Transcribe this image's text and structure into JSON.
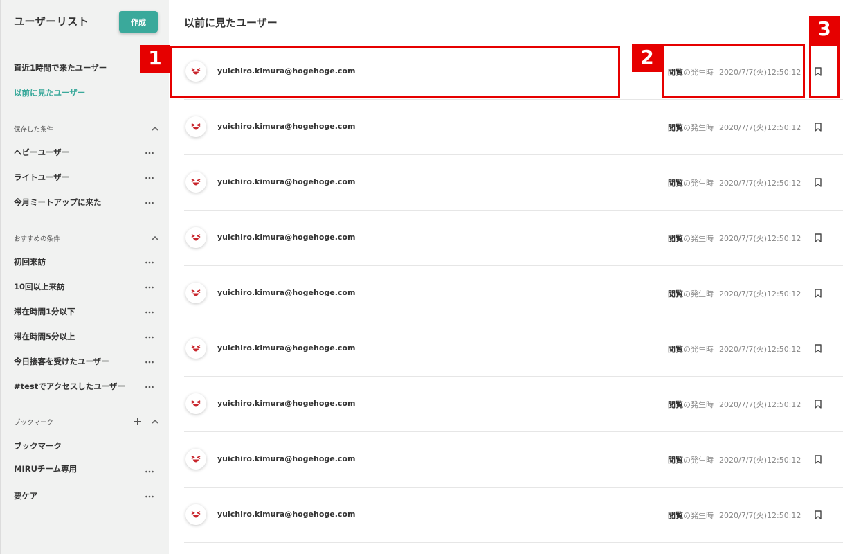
{
  "sidebar": {
    "title": "ユーザーリスト",
    "create_label": "作成",
    "top_items": [
      {
        "label": "直近1時間で来たユーザー"
      },
      {
        "label": "以前に見たユーザー"
      }
    ],
    "saved_section": {
      "label": "保存した条件",
      "items": [
        {
          "label": "ヘビーユーザー"
        },
        {
          "label": "ライトユーザー"
        },
        {
          "label": "今月ミートアップに来た"
        }
      ]
    },
    "recommended_section": {
      "label": "おすすめの条件",
      "items": [
        {
          "label": "初回来訪"
        },
        {
          "label": "10回以上来訪"
        },
        {
          "label": "滞在時間1分以下"
        },
        {
          "label": "滞在時間5分以上"
        },
        {
          "label": "今日接客を受けたユーザー"
        },
        {
          "label": "#testでアクセスしたユーザー"
        }
      ]
    },
    "bookmark_section": {
      "label": "ブックマーク",
      "items": [
        {
          "label": "ブックマーク"
        },
        {
          "label": "MIRUチーム専用"
        },
        {
          "label": "要ケア"
        }
      ]
    }
  },
  "main": {
    "title": "以前に見たユーザー",
    "rows": [
      {
        "email": "yuichiro.kimura@hogehoge.com",
        "event_kind": "閲覧",
        "event_suffix": "の発生時",
        "time": "2020/7/7(火)12:50:12"
      },
      {
        "email": "yuichiro.kimura@hogehoge.com",
        "event_kind": "閲覧",
        "event_suffix": "の発生時",
        "time": "2020/7/7(火)12:50:12"
      },
      {
        "email": "yuichiro.kimura@hogehoge.com",
        "event_kind": "閲覧",
        "event_suffix": "の発生時",
        "time": "2020/7/7(火)12:50:12"
      },
      {
        "email": "yuichiro.kimura@hogehoge.com",
        "event_kind": "閲覧",
        "event_suffix": "の発生時",
        "time": "2020/7/7(火)12:50:12"
      },
      {
        "email": "yuichiro.kimura@hogehoge.com",
        "event_kind": "閲覧",
        "event_suffix": "の発生時",
        "time": "2020/7/7(火)12:50:12"
      },
      {
        "email": "yuichiro.kimura@hogehoge.com",
        "event_kind": "閲覧",
        "event_suffix": "の発生時",
        "time": "2020/7/7(火)12:50:12"
      },
      {
        "email": "yuichiro.kimura@hogehoge.com",
        "event_kind": "閲覧",
        "event_suffix": "の発生時",
        "time": "2020/7/7(火)12:50:12"
      },
      {
        "email": "yuichiro.kimura@hogehoge.com",
        "event_kind": "閲覧",
        "event_suffix": "の発生時",
        "time": "2020/7/7(火)12:50:12"
      },
      {
        "email": "yuichiro.kimura@hogehoge.com",
        "event_kind": "閲覧",
        "event_suffix": "の発生時",
        "time": "2020/7/7(火)12:50:12"
      }
    ]
  },
  "callouts": [
    "1",
    "2",
    "3"
  ],
  "colors": {
    "accent": "#3aa99b",
    "callout": "#e60000",
    "sidebar_bg": "#f1f2f1",
    "avatar_icon": "#c8252c"
  },
  "icons": {
    "avatar": "smiling-face-icon",
    "bookmark": "bookmark-icon",
    "more": "more-dots-icon",
    "collapse": "chevron-up-icon",
    "add": "plus-icon"
  }
}
